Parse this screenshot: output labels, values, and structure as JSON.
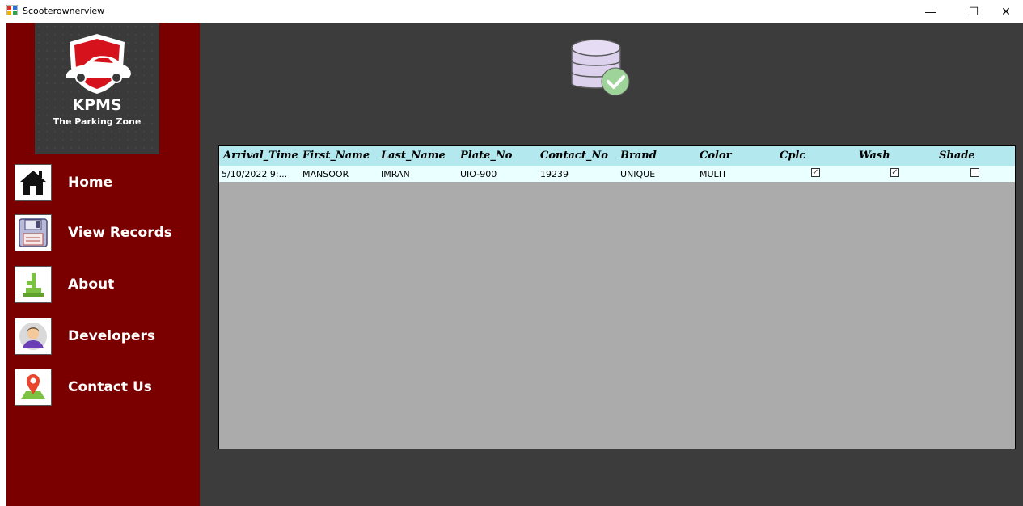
{
  "window": {
    "title": "Scooterownerview",
    "minimize_glyph": "—",
    "maximize_glyph": "☐",
    "close_glyph": "✕"
  },
  "brand": {
    "name": "KPMS",
    "tagline": "The Parking Zone"
  },
  "nav": {
    "items": [
      {
        "label": "Home",
        "icon": "home-icon"
      },
      {
        "label": "View Records",
        "icon": "floppy-disk-icon"
      },
      {
        "label": "About",
        "icon": "about-icon"
      },
      {
        "label": "Developers",
        "icon": "developer-avatar-icon"
      },
      {
        "label": "Contact Us",
        "icon": "map-pin-icon"
      }
    ]
  },
  "grid": {
    "columns": [
      "Arrival_Time",
      "First_Name",
      "Last_Name",
      "Plate_No",
      "Contact_No",
      "Brand",
      "Color",
      "Cplc",
      "Wash",
      "Shade"
    ],
    "rows": [
      {
        "Arrival_Time": "5/10/2022 9:...",
        "First_Name": "MANSOOR",
        "Last_Name": "IMRAN",
        "Plate_No": "UIO-900",
        "Contact_No": "19239",
        "Brand": "UNIQUE",
        "Color": "MULTI",
        "Cplc": true,
        "Wash": true,
        "Shade": false
      }
    ]
  },
  "colors": {
    "sidebar": "#7a0000",
    "background": "#3c3c3c",
    "grid_header": "#b2e8ee",
    "grid_body": "#ababab"
  }
}
